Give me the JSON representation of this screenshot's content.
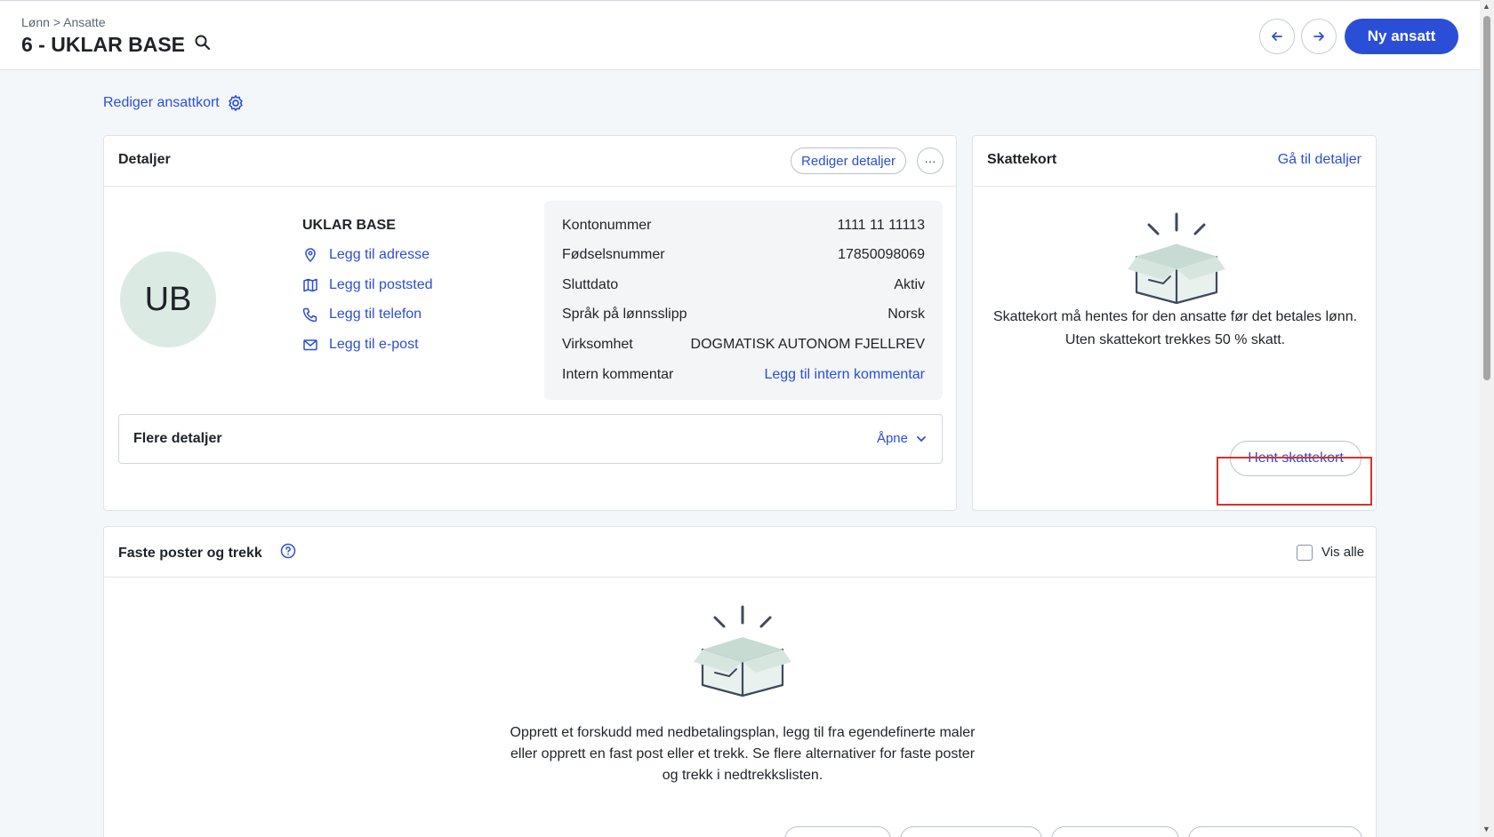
{
  "header": {
    "breadcrumb": {
      "parent": "Lønn",
      "separator": ">",
      "current": "Ansatte"
    },
    "title": "6 - UKLAR BASE",
    "new_employee_label": "Ny ansatt"
  },
  "edit_card_label": "Rediger ansattkort",
  "details": {
    "title": "Detaljer",
    "edit_label": "Rediger detaljer",
    "more_label": "···",
    "avatar_initials": "UB",
    "name": "UKLAR BASE",
    "contacts": [
      {
        "label": "Legg til adresse",
        "icon": "location-pin-icon"
      },
      {
        "label": "Legg til poststed",
        "icon": "map-icon"
      },
      {
        "label": "Legg til telefon",
        "icon": "phone-icon"
      },
      {
        "label": "Legg til e-post",
        "icon": "mail-icon"
      }
    ],
    "info_rows": [
      {
        "label": "Kontonummer",
        "value": "1111 11 11113"
      },
      {
        "label": "Fødselsnummer",
        "value": "17850098069"
      },
      {
        "label": "Sluttdato",
        "value": "Aktiv"
      },
      {
        "label": "Språk på lønnsslipp",
        "value": "Norsk"
      },
      {
        "label": "Virksomhet",
        "value": "DOGMATISK AUTONOM FJELLREV"
      },
      {
        "label": "Intern kommentar",
        "value": "Legg til intern kommentar"
      }
    ],
    "more_details": {
      "title": "Flere detaljer",
      "toggle_label": "Åpne"
    }
  },
  "tax_card": {
    "title": "Skattekort",
    "details_link": "Gå til detaljer",
    "empty_text": "Skattekort må hentes for den ansatte før det betales lønn. Uten skattekort trekkes 50 % skatt.",
    "fetch_label": "Hent skattekort"
  },
  "fixed_items": {
    "title": "Faste poster og trekk",
    "show_all_label": "Vis alle",
    "empty_text": "Opprett et forskudd med nedbetalingsplan, legg til fra egendefinerte maler eller opprett en fast post eller et trekk. Se flere alternativer for faste poster og trekk i nedtrekkslisten."
  },
  "colors": {
    "accent": "#2a4fd6",
    "avatar_bg": "#dceae4",
    "highlight": "#d9302b"
  }
}
